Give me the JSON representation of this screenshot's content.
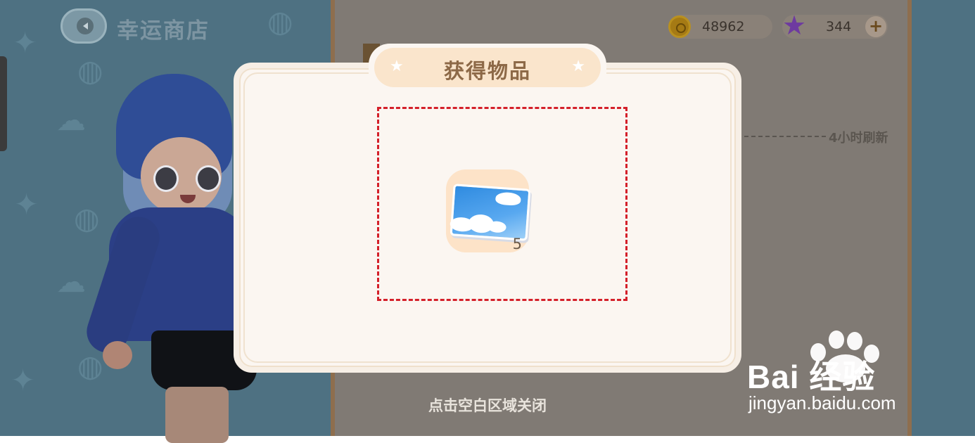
{
  "header": {
    "title": "幸运商店",
    "back_icon": "chevron-left-icon"
  },
  "currency": {
    "coins": {
      "icon": "coin-icon",
      "value": "48962"
    },
    "stars": {
      "icon": "star-icon",
      "value": "344",
      "add_label": "+"
    }
  },
  "shop": {
    "refresh_text": "4小时刷新"
  },
  "dialog": {
    "title": "获得物品",
    "title_decoration_icon": "star-icon",
    "items": [
      {
        "icon": "sky-whale-picture-icon",
        "count": "5"
      }
    ],
    "highlight_color": "#d4202a"
  },
  "close_hint": "点击空白区域关闭",
  "watermark": {
    "brand": "Bai  经验",
    "url": "jingyan.baidu.com"
  },
  "colors": {
    "dialog_bg": "#fbf6f1",
    "title_pill": "#fae5cc",
    "title_text": "#8d6947",
    "item_card": "#fde3c8"
  }
}
